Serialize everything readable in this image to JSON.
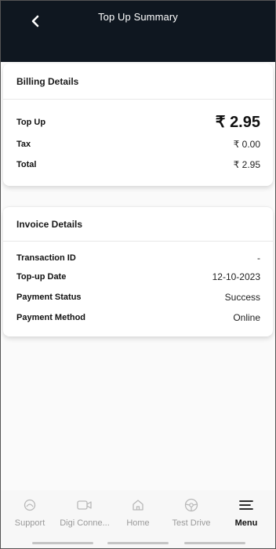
{
  "header": {
    "title": "Top Up Summary"
  },
  "billing": {
    "title": "Billing Details",
    "rows": [
      {
        "label": "Top Up",
        "value": "₹ 2.95"
      },
      {
        "label": "Tax",
        "value": "₹ 0.00"
      },
      {
        "label": "Total",
        "value": "₹ 2.95"
      }
    ]
  },
  "invoice": {
    "title": "Invoice Details",
    "rows": [
      {
        "label": "Transaction ID",
        "value": "-"
      },
      {
        "label": "Top-up Date",
        "value": "12-10-2023"
      },
      {
        "label": "Payment Status",
        "value": "Success"
      },
      {
        "label": "Payment Method",
        "value": "Online"
      }
    ]
  },
  "nav": {
    "items": [
      {
        "label": "Support",
        "icon": "support-icon"
      },
      {
        "label": "Digi Conne...",
        "icon": "video-icon"
      },
      {
        "label": "Home",
        "icon": "home-icon"
      },
      {
        "label": "Test Drive",
        "icon": "steering-wheel-icon"
      },
      {
        "label": "Menu",
        "icon": "menu-icon",
        "active": true
      }
    ]
  },
  "colors": {
    "header_bg": "#0f1720",
    "active_nav": "#111111",
    "inactive_nav": "#9a9a9a"
  }
}
